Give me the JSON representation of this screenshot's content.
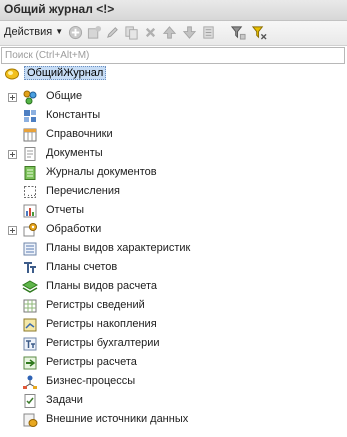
{
  "window": {
    "title": "Общий журнал <!>"
  },
  "toolbar": {
    "actions_label": "Действия"
  },
  "search": {
    "placeholder": "Поиск (Ctrl+Alt+M)",
    "value": ""
  },
  "tree": {
    "root": {
      "label": "ОбщийЖурнал",
      "icon": "journal-root-icon"
    },
    "items": [
      {
        "label": "Общие",
        "icon": "common-icon",
        "expandable": true
      },
      {
        "label": "Константы",
        "icon": "constants-icon",
        "expandable": false
      },
      {
        "label": "Справочники",
        "icon": "catalogs-icon",
        "expandable": false
      },
      {
        "label": "Документы",
        "icon": "documents-icon",
        "expandable": true
      },
      {
        "label": "Журналы документов",
        "icon": "document-journals-icon",
        "expandable": false
      },
      {
        "label": "Перечисления",
        "icon": "enumerations-icon",
        "expandable": false
      },
      {
        "label": "Отчеты",
        "icon": "reports-icon",
        "expandable": false
      },
      {
        "label": "Обработки",
        "icon": "data-processors-icon",
        "expandable": true
      },
      {
        "label": "Планы видов характеристик",
        "icon": "chart-of-characteristic-types-icon",
        "expandable": false
      },
      {
        "label": "Планы счетов",
        "icon": "chart-of-accounts-icon",
        "expandable": false
      },
      {
        "label": "Планы видов расчета",
        "icon": "chart-of-calculation-types-icon",
        "expandable": false
      },
      {
        "label": "Регистры сведений",
        "icon": "information-registers-icon",
        "expandable": false
      },
      {
        "label": "Регистры накопления",
        "icon": "accumulation-registers-icon",
        "expandable": false
      },
      {
        "label": "Регистры бухгалтерии",
        "icon": "accounting-registers-icon",
        "expandable": false
      },
      {
        "label": "Регистры расчета",
        "icon": "calculation-registers-icon",
        "expandable": false
      },
      {
        "label": "Бизнес-процессы",
        "icon": "business-processes-icon",
        "expandable": false
      },
      {
        "label": "Задачи",
        "icon": "tasks-icon",
        "expandable": false
      },
      {
        "label": "Внешние источники данных",
        "icon": "external-data-sources-icon",
        "expandable": false
      }
    ]
  }
}
